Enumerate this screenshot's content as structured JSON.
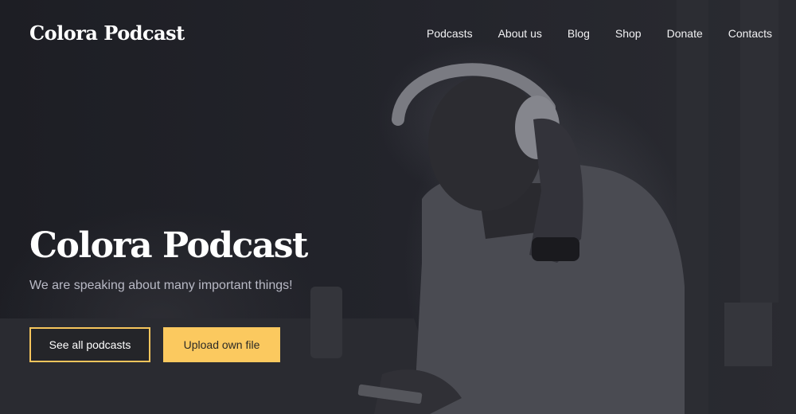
{
  "header": {
    "brand": "Colora Podcast",
    "nav": [
      {
        "label": "Podcasts"
      },
      {
        "label": "About us"
      },
      {
        "label": "Blog"
      },
      {
        "label": "Shop"
      },
      {
        "label": "Donate"
      },
      {
        "label": "Contacts"
      }
    ]
  },
  "hero": {
    "title": "Colora Podcast",
    "subtitle": "We are speaking about many important things!",
    "primary_button": "See all podcasts",
    "secondary_button": "Upload own file",
    "background_image": "man-with-headphones-photo"
  },
  "colors": {
    "accent": "#fbc95f",
    "background": "#1f2026",
    "text": "#ffffff",
    "muted_text": "#b9bac6"
  }
}
